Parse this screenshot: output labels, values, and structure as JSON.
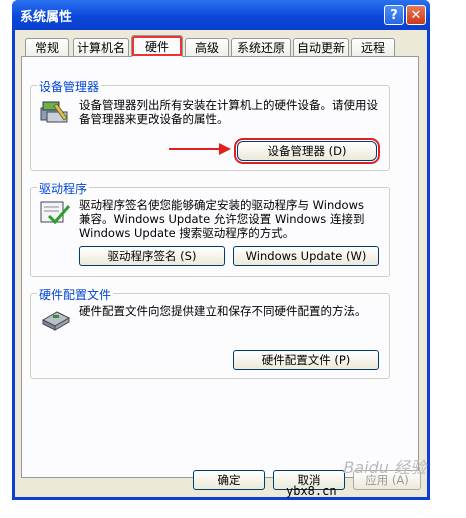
{
  "window": {
    "title": "系统属性",
    "help": "?",
    "close": "✕"
  },
  "tabs": [
    {
      "label": "常规"
    },
    {
      "label": "计算机名"
    },
    {
      "label": "硬件"
    },
    {
      "label": "高级"
    },
    {
      "label": "系统还原"
    },
    {
      "label": "自动更新"
    },
    {
      "label": "远程"
    }
  ],
  "device_manager": {
    "title": "设备管理器",
    "desc": "设备管理器列出所有安装在计算机上的硬件设备。请使用设备管理器来更改设备的属性。",
    "button": "设备管理器 (D)"
  },
  "drivers": {
    "title": "驱动程序",
    "desc": "驱动程序签名使您能够确定安装的驱动程序与 Windows 兼容。Windows Update 允许您设置 Windows 连接到 Windows Update 搜索驱动程序的方式。",
    "sign_button": "驱动程序签名 (S)",
    "update_button": "Windows Update (W)"
  },
  "hw_profiles": {
    "title": "硬件配置文件",
    "desc": "硬件配置文件向您提供建立和保存不同硬件配置的方法。",
    "button": "硬件配置文件 (P)"
  },
  "footer": {
    "ok": "确定",
    "cancel": "取消",
    "apply": "应用 (A)"
  },
  "watermark": "Baidu 经验",
  "site": "ybx8.cn",
  "colors": {
    "title_blue": "#0a48d8",
    "legend_blue": "#0046d5",
    "highlight_red": "#e02020"
  }
}
